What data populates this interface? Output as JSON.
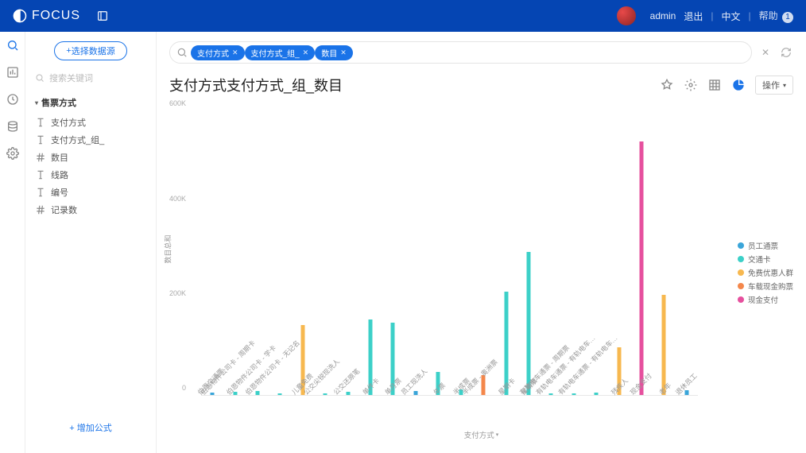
{
  "header": {
    "app_name": "FOCUS",
    "user": "admin",
    "logout": "退出",
    "lang": "中文",
    "help": "帮助"
  },
  "sidebar": {
    "select_source_btn": "选择数据源",
    "search_placeholder": "搜索关键词",
    "group_title": "售票方式",
    "items": [
      "支付方式",
      "支付方式_组_",
      "数目",
      "线路",
      "编号",
      "记录数"
    ],
    "add_formula": "增加公式"
  },
  "query": {
    "tags": [
      "支付方式",
      "支付方式_组_",
      "数目"
    ]
  },
  "title": "支付方式支付方式_组_数目",
  "actions": {
    "ops_label": "操作"
  },
  "chart_data": {
    "type": "bar",
    "ylabel": "数目总和",
    "xlabel": "支付方式",
    "ylim": [
      0,
      600000
    ],
    "yticks": [
      "0",
      "200K",
      "400K",
      "600K"
    ],
    "series": [
      {
        "name": "员工通票",
        "color": "c0"
      },
      {
        "name": "交通卡",
        "color": "c1"
      },
      {
        "name": "免费优惠人群",
        "color": "c2"
      },
      {
        "name": "车载现金购票",
        "color": "c3"
      },
      {
        "name": "现金支付",
        "color": "c4"
      }
    ],
    "categories": [
      "伯恩交通票",
      "伯恩物件公司卡 - 周期卡",
      "伯恩物件公司卡 - 学卡",
      "伯恩物件公司卡 - 无记名",
      "儿童免费",
      "公交尖锐现洗人",
      "公交还原笔",
      "单件卡",
      "单月票",
      "员工现洗人",
      "年票",
      "半成票",
      "半成票 - 奥洲票",
      "星期卡",
      "星期票",
      "有轨电车通票 - 周期票",
      "有轨电车通票 - 有轨电车…",
      "有轨电车通票 - 有轨电车…",
      "残疾人",
      "现金支付",
      "老年",
      "退休员工"
    ],
    "values_by_cat": {
      "bars": [
        [
          [
            "c0",
            5
          ]
        ],
        [
          [
            "c1",
            7
          ]
        ],
        [
          [
            "c1",
            8
          ]
        ],
        [
          [
            "c1",
            3
          ]
        ],
        [
          [
            "c2",
            148
          ]
        ],
        [
          [
            "c1",
            3
          ]
        ],
        [
          [
            "c1",
            6
          ]
        ],
        [
          [
            "c1",
            160
          ]
        ],
        [
          [
            "c1",
            153
          ]
        ],
        [
          [
            "c0",
            8
          ]
        ],
        [
          [
            "c1",
            48
          ]
        ],
        [
          [
            "c1",
            12
          ]
        ],
        [
          [
            "c3",
            42
          ]
        ],
        [
          [
            "c1",
            218
          ]
        ],
        [
          [
            "c1",
            302
          ]
        ],
        [
          [
            "c1",
            3
          ]
        ],
        [
          [
            "c1",
            4
          ]
        ],
        [
          [
            "c1",
            5
          ]
        ],
        [
          [
            "c2",
            100
          ]
        ],
        [
          [
            "c4",
            535
          ]
        ],
        [
          [
            "c2",
            212
          ]
        ],
        [
          [
            "c0",
            10
          ]
        ]
      ]
    }
  }
}
